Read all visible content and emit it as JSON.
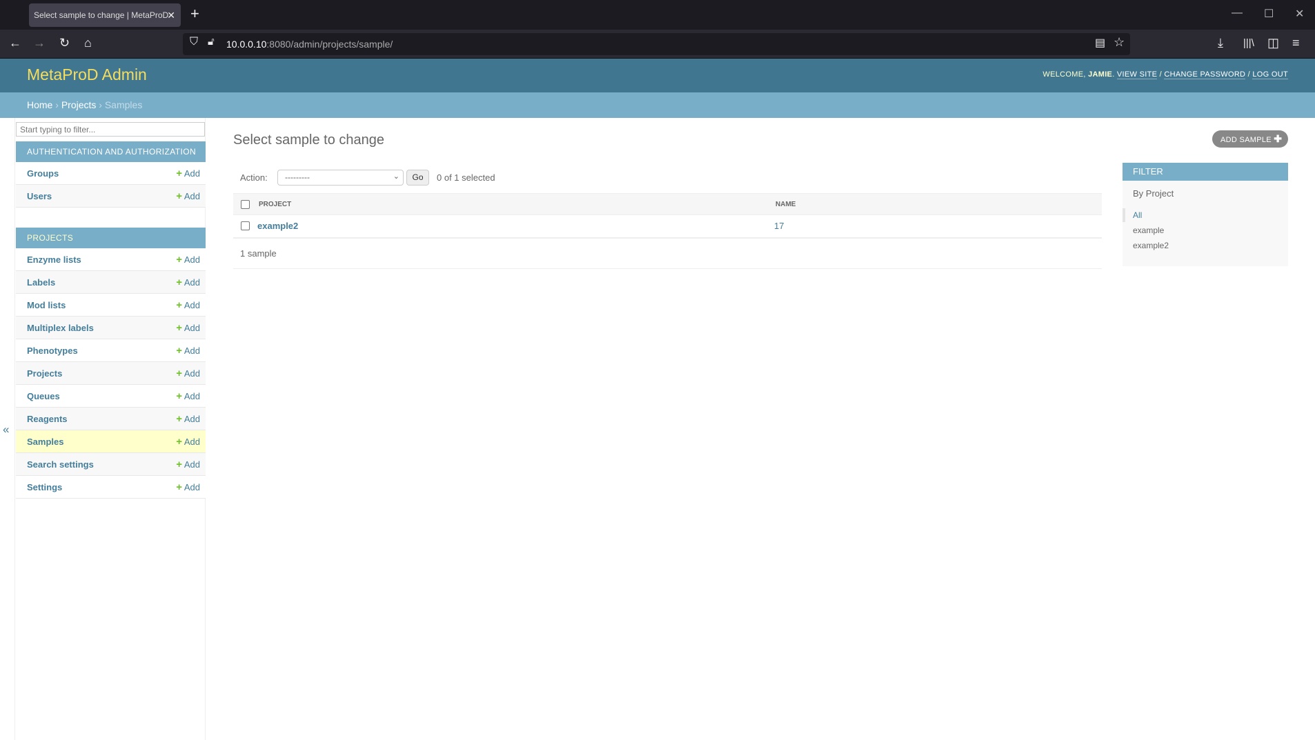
{
  "browser": {
    "tab_title": "Select sample to change | MetaProD",
    "url_host": "10.0.0.10",
    "url_path": ":8080/admin/projects/sample/"
  },
  "header": {
    "brand": "MetaProD Admin",
    "welcome": "WELCOME, ",
    "user": "JAMIE",
    "view_site": "VIEW SITE",
    "change_password": "CHANGE PASSWORD",
    "log_out": "LOG OUT",
    "sep": " / "
  },
  "breadcrumbs": {
    "home": "Home",
    "projects": "Projects",
    "current": "Samples",
    "sep": " › "
  },
  "sidebar": {
    "filter_placeholder": "Start typing to filter...",
    "add_label": "Add",
    "sections": [
      {
        "caption": "AUTHENTICATION AND AUTHORIZATION",
        "items": [
          "Groups",
          "Users"
        ]
      },
      {
        "caption": "PROJECTS",
        "items": [
          "Enzyme lists",
          "Labels",
          "Mod lists",
          "Multiplex labels",
          "Phenotypes",
          "Projects",
          "Queues",
          "Reagents",
          "Samples",
          "Search settings",
          "Settings"
        ]
      }
    ],
    "active_item": "Samples"
  },
  "main": {
    "title": "Select sample to change",
    "add_button": "ADD SAMPLE",
    "action_label": "Action:",
    "action_value": "---------",
    "go": "Go",
    "selected": "0 of 1 selected",
    "columns": [
      "PROJECT",
      "NAME"
    ],
    "rows": [
      {
        "project": "example2",
        "name": "17"
      }
    ],
    "count": "1 sample"
  },
  "filter": {
    "title": "FILTER",
    "by": "By Project",
    "options": [
      "All",
      "example",
      "example2"
    ],
    "selected": "All"
  },
  "colors": {
    "header": "#417690",
    "brand": "#f5dd5d",
    "breadcrumb": "#79aec8",
    "link": "#447e9b",
    "add_green": "#70bf2b",
    "active_row": "#ffffcc"
  }
}
